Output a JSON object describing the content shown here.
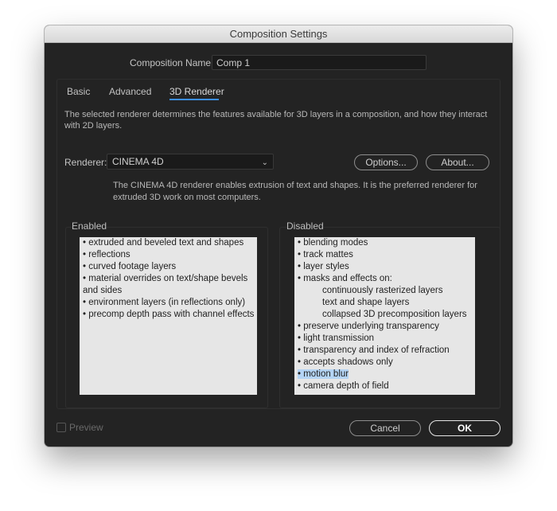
{
  "window": {
    "title": "Composition Settings"
  },
  "composition_name": {
    "label": "Composition Name:",
    "value": "Comp 1"
  },
  "tabs": [
    {
      "label": "Basic"
    },
    {
      "label": "Advanced"
    },
    {
      "label": "3D Renderer"
    }
  ],
  "description": "The selected renderer determines the features available for 3D layers in a composition, and how they interact with 2D layers.",
  "renderer": {
    "label": "Renderer:",
    "selected": "CINEMA 4D",
    "options_button": "Options...",
    "about_button": "About...",
    "note": "The CINEMA 4D renderer enables extrusion of text and shapes. It is the preferred renderer for extruded 3D work on most computers."
  },
  "enabled": {
    "label": "Enabled",
    "items": [
      "• extruded and beveled text and shapes",
      "• reflections",
      "• curved footage layers",
      "• material overrides on text/shape bevels and sides",
      "• environment layers (in reflections only)",
      "• precomp depth pass with channel effects"
    ]
  },
  "disabled": {
    "label": "Disabled",
    "items": [
      "• blending modes",
      "• track mattes",
      "• layer styles",
      "• masks and effects on:",
      "continuously rasterized layers",
      "text and shape layers",
      "collapsed 3D precomposition layers",
      "• preserve underlying transparency",
      "• light transmission",
      "• transparency and index of refraction",
      "• accepts shadows only",
      "• motion blur",
      "• camera depth of field"
    ]
  },
  "footer": {
    "preview": "Preview",
    "cancel": "Cancel",
    "ok": "OK"
  }
}
